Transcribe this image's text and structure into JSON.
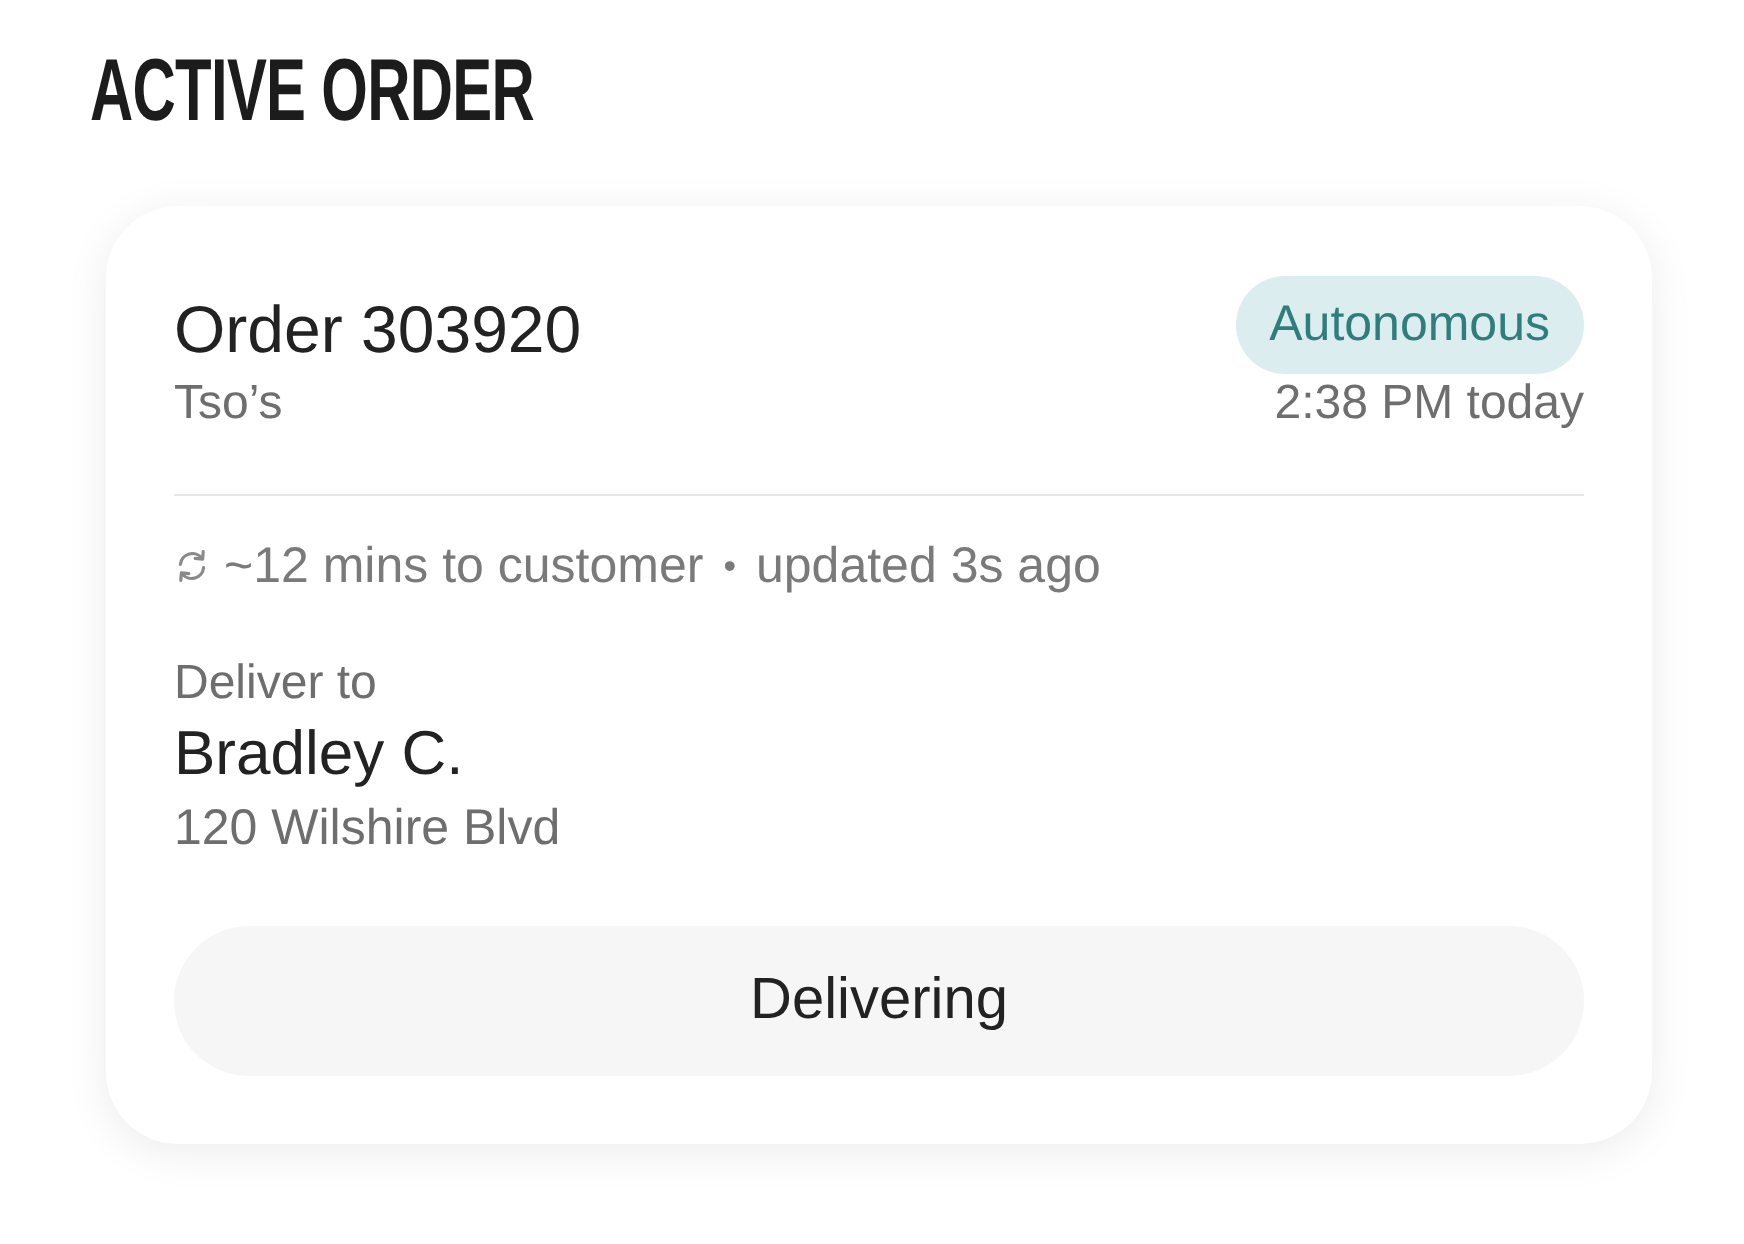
{
  "heading": "ACTIVE ORDER",
  "order": {
    "title": "Order 303920",
    "restaurant": "Tso’s",
    "badge": "Autonomous",
    "time": "2:38 PM today"
  },
  "status_line": {
    "eta": "~12 mins to customer",
    "separator": "•",
    "updated": "updated 3s ago"
  },
  "delivery": {
    "label": "Deliver to",
    "name": "Bradley C.",
    "address": "120 Wilshire Blvd"
  },
  "action": {
    "label": "Delivering"
  }
}
